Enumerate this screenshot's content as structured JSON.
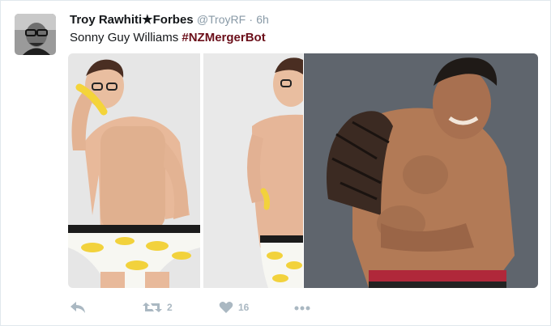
{
  "tweet": {
    "author_name": "Troy Rawhiti★Forbes",
    "author_handle": "@TroyRF",
    "separator": "·",
    "time": "6h",
    "text": "Sonny Guy Williams ",
    "hashtag": "#NZMergerBot"
  },
  "actions": {
    "reply_icon": "reply-icon",
    "retweet_icon": "retweet-icon",
    "retweet_count": "2",
    "like_icon": "heart-icon",
    "like_count": "16",
    "more_icon": "more-icon"
  },
  "colors": {
    "hashtag": "#6b0f1a",
    "meta": "#8899a6",
    "action": "#aab8c2"
  }
}
